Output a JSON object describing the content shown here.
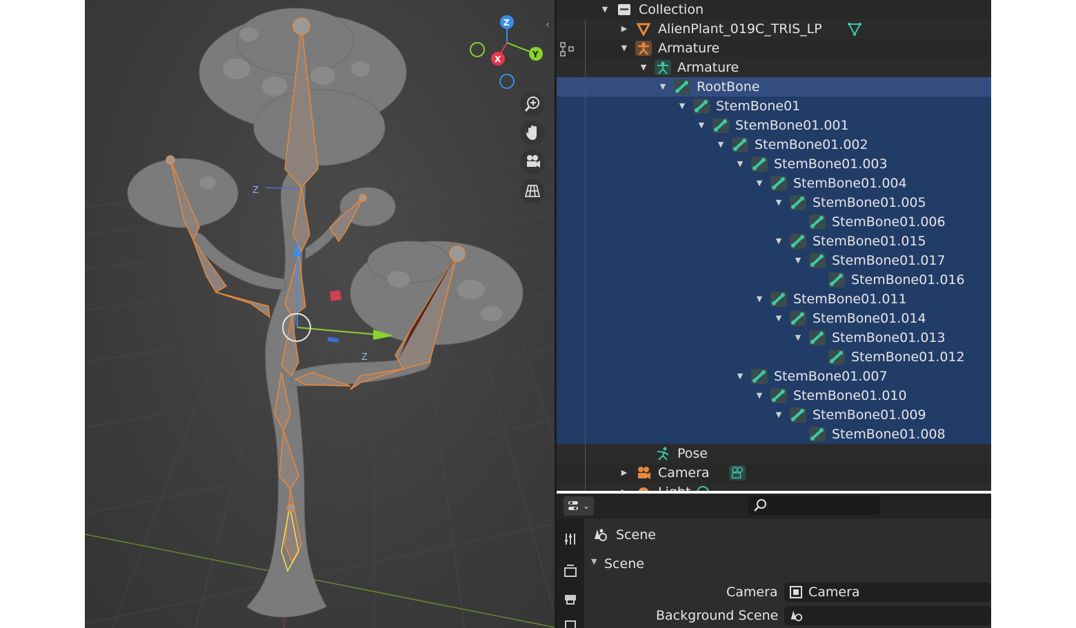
{
  "viewport": {
    "gizmo": {
      "x": "X",
      "y": "Y",
      "z": "Z"
    },
    "bone_axis_label": "Z",
    "nav_icons": [
      "zoom-icon",
      "pan-hand-icon",
      "camera-view-icon",
      "grid-view-icon"
    ]
  },
  "outliner": {
    "rows": [
      {
        "label": "Collection",
        "icon": "collection-icon"
      },
      {
        "label": "AlienPlant_019C_TRIS_LP",
        "icon": "mesh-icon"
      },
      {
        "label": "Armature",
        "icon": "armature-object-icon"
      },
      {
        "label": "Armature",
        "icon": "armature-data-icon"
      },
      {
        "label": "RootBone",
        "icon": "bone-icon"
      },
      {
        "label": "StemBone01",
        "icon": "bone-icon"
      },
      {
        "label": "StemBone01.001",
        "icon": "bone-icon"
      },
      {
        "label": "StemBone01.002",
        "icon": "bone-icon"
      },
      {
        "label": "StemBone01.003",
        "icon": "bone-icon"
      },
      {
        "label": "StemBone01.004",
        "icon": "bone-icon"
      },
      {
        "label": "StemBone01.005",
        "icon": "bone-icon"
      },
      {
        "label": "StemBone01.006",
        "icon": "bone-icon"
      },
      {
        "label": "StemBone01.015",
        "icon": "bone-icon"
      },
      {
        "label": "StemBone01.017",
        "icon": "bone-icon"
      },
      {
        "label": "StemBone01.016",
        "icon": "bone-icon"
      },
      {
        "label": "StemBone01.011",
        "icon": "bone-icon"
      },
      {
        "label": "StemBone01.014",
        "icon": "bone-icon"
      },
      {
        "label": "StemBone01.013",
        "icon": "bone-icon"
      },
      {
        "label": "StemBone01.012",
        "icon": "bone-icon"
      },
      {
        "label": "StemBone01.007",
        "icon": "bone-icon"
      },
      {
        "label": "StemBone01.010",
        "icon": "bone-icon"
      },
      {
        "label": "StemBone01.009",
        "icon": "bone-icon"
      },
      {
        "label": "StemBone01.008",
        "icon": "bone-icon"
      },
      {
        "label": "Pose",
        "icon": "pose-icon"
      },
      {
        "label": "Camera",
        "icon": "camera-object-icon"
      },
      {
        "label": "Light",
        "icon": "light-object-icon"
      }
    ]
  },
  "properties": {
    "search_placeholder": "",
    "header_title": "Scene",
    "panel_title": "Scene",
    "fields": [
      {
        "label": "Camera",
        "value": "Camera"
      },
      {
        "label": "Background Scene",
        "value": ""
      }
    ]
  },
  "colors": {
    "selection": "#334d80",
    "highlight": "#223c68",
    "bone_outline": "#e8883a",
    "axis_x": "#e53950",
    "axis_y": "#8bd12f",
    "axis_z": "#3b8ee8"
  }
}
